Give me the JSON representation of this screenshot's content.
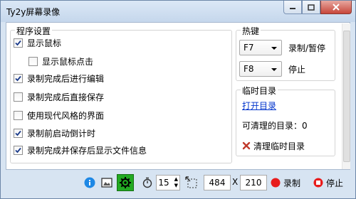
{
  "window": {
    "title": "Ty2y屏幕录像"
  },
  "settings": {
    "label": "程序设置",
    "items": [
      {
        "label": "显示鼠标",
        "checked": true
      },
      {
        "label": "显示鼠标点击",
        "checked": false
      },
      {
        "label": "录制完成后进行编辑",
        "checked": true
      },
      {
        "label": "录制完成后直接保存",
        "checked": false
      },
      {
        "label": "使用现代风格的界面",
        "checked": false
      },
      {
        "label": "录制前启动倒计时",
        "checked": true
      },
      {
        "label": "录制完成并保存后显示文件信息",
        "checked": true
      }
    ]
  },
  "hotkeys": {
    "label": "热键",
    "record_key": "F7",
    "record_label": "录制/暂停",
    "stop_key": "F8",
    "stop_label": "停止"
  },
  "tempdir": {
    "label": "临时目录",
    "open_link": "打开目录",
    "cleanable": "可清理的目录：0",
    "clear_label": "清理临时目录"
  },
  "toolbar": {
    "countdown": "15",
    "width": "484",
    "x_sep": "X",
    "height": "210",
    "record_label": "录制",
    "stop_label": "停止"
  },
  "colors": {
    "accent": "#0033cc",
    "record": "#e81c1c",
    "settings_active": "#22aa22"
  }
}
